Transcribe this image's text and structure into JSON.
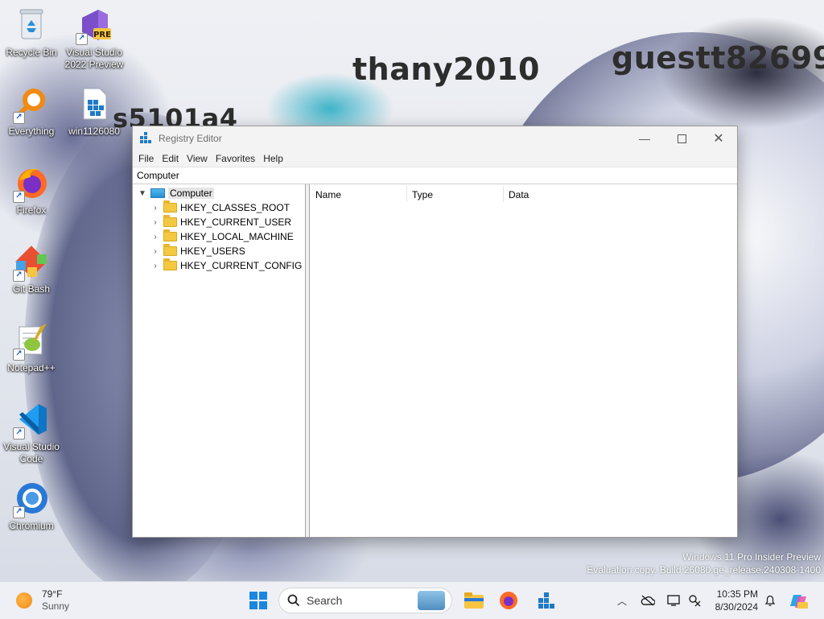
{
  "wallpaper": {
    "texts": [
      "thany2010",
      "guestt82699",
      "s5101a4"
    ]
  },
  "desktop_icons": [
    {
      "label": "Recycle Bin",
      "icon": "recycle-bin-icon"
    },
    {
      "label": "Visual Studio 2022 Preview",
      "icon": "visual-studio-preview-icon",
      "badge": "PRE"
    },
    {
      "label": "Everything",
      "icon": "everything-search-icon"
    },
    {
      "label": "win1126080",
      "icon": "registry-file-icon"
    },
    {
      "label": "Firefox",
      "icon": "firefox-icon"
    },
    {
      "label": "Git Bash",
      "icon": "git-bash-icon"
    },
    {
      "label": "Notepad++",
      "icon": "notepad-plus-plus-icon"
    },
    {
      "label": "Visual Studio Code",
      "icon": "vscode-icon"
    },
    {
      "label": "Chromium",
      "icon": "chromium-icon"
    }
  ],
  "window": {
    "title": "Registry Editor",
    "menu": [
      "File",
      "Edit",
      "View",
      "Favorites",
      "Help"
    ],
    "address": "Computer",
    "tree": {
      "root": "Computer",
      "children": [
        "HKEY_CLASSES_ROOT",
        "HKEY_CURRENT_USER",
        "HKEY_LOCAL_MACHINE",
        "HKEY_USERS",
        "HKEY_CURRENT_CONFIG"
      ]
    },
    "columns": [
      "Name",
      "Type",
      "Data"
    ]
  },
  "watermark": {
    "line1": "Windows 11 Pro Insider Preview",
    "line2": "Evaluation copy. Build 26080.ge_release.240308-1400"
  },
  "taskbar": {
    "weather": {
      "temp": "79°F",
      "condition": "Sunny"
    },
    "search_placeholder": "Search",
    "pinned": [
      "start-icon",
      "search-icon",
      "file-explorer-icon",
      "firefox-icon",
      "registry-editor-icon"
    ],
    "tray": [
      "chevron-up-icon",
      "onedrive-offline-icon",
      "display-icon",
      "network-icon",
      "notification-bell-icon",
      "copilot-icon"
    ],
    "time": "10:35 PM",
    "date": "8/30/2024"
  }
}
